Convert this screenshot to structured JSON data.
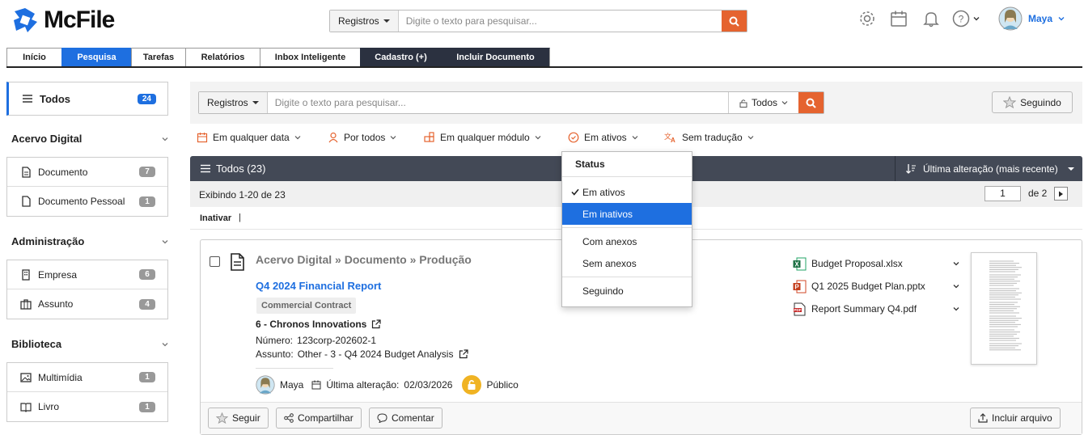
{
  "brand": {
    "name": "McFile"
  },
  "header": {
    "search_scope": "Registros",
    "search_placeholder": "Digite o texto para pesquisar...",
    "user_name": "Maya"
  },
  "nav": {
    "tabs": [
      "Início",
      "Pesquisa",
      "Tarefas",
      "Relatórios",
      "Inbox Inteligente",
      "Cadastro (+)",
      "Incluir Documento"
    ]
  },
  "sidebar": {
    "all_label": "Todos",
    "all_count": "24",
    "sections": [
      {
        "title": "Acervo Digital",
        "items": [
          {
            "label": "Documento",
            "count": "7"
          },
          {
            "label": "Documento Pessoal",
            "count": "1"
          }
        ]
      },
      {
        "title": "Administração",
        "items": [
          {
            "label": "Empresa",
            "count": "6"
          },
          {
            "label": "Assunto",
            "count": "4"
          }
        ]
      },
      {
        "title": "Biblioteca",
        "items": [
          {
            "label": "Multimídia",
            "count": "1"
          },
          {
            "label": "Livro",
            "count": "1"
          }
        ]
      }
    ]
  },
  "search": {
    "scope": "Registros",
    "placeholder": "Digite o texto para pesquisar...",
    "filter_all": "Todos",
    "following_label": "Seguindo"
  },
  "filters": {
    "date": "Em qualquer data",
    "by": "Por todos",
    "module": "Em qualquer módulo",
    "status": "Em ativos",
    "translation": "Sem tradução"
  },
  "list": {
    "title": "Todos (23)",
    "sort_label": "Última alteração (mais recente)",
    "showing": "Exibindo 1-20 de 23",
    "page": "1",
    "of_pages": "de 2",
    "inactivate": "Inativar",
    "sep": "|"
  },
  "dropdown": {
    "header": "Status",
    "items": [
      "Em ativos",
      "Em inativos",
      "Com anexos",
      "Sem anexos",
      "Seguindo"
    ],
    "checked": "Em ativos",
    "highlighted": "Em inativos"
  },
  "record": {
    "breadcrumb": "Acervo Digital » Documento » Produção",
    "title": "Q4 2024 Financial Report",
    "tag": "Commercial Contract",
    "company": "6 - Chronos Innovations",
    "number_label": "Número:",
    "number": "123corp-202602-1",
    "subject_label": "Assunto:",
    "subject": "Other - 3 - Q4 2024 Budget Analysis",
    "owner": "Maya",
    "modified_label": "Última alteração:",
    "modified": "02/03/2026",
    "visibility": "Público",
    "files": [
      {
        "name": "Budget Proposal.xlsx",
        "type": "xlsx"
      },
      {
        "name": "Q1 2025 Budget Plan.pptx",
        "type": "pptx"
      },
      {
        "name": "Report Summary Q4.pdf",
        "type": "pdf"
      }
    ],
    "actions": {
      "follow": "Seguir",
      "share": "Compartilhar",
      "comment": "Comentar",
      "add_file": "Incluir arquivo"
    }
  },
  "colors": {
    "accent": "#1e6fe0",
    "search_button": "#e5632f",
    "list_bar": "#434956"
  }
}
